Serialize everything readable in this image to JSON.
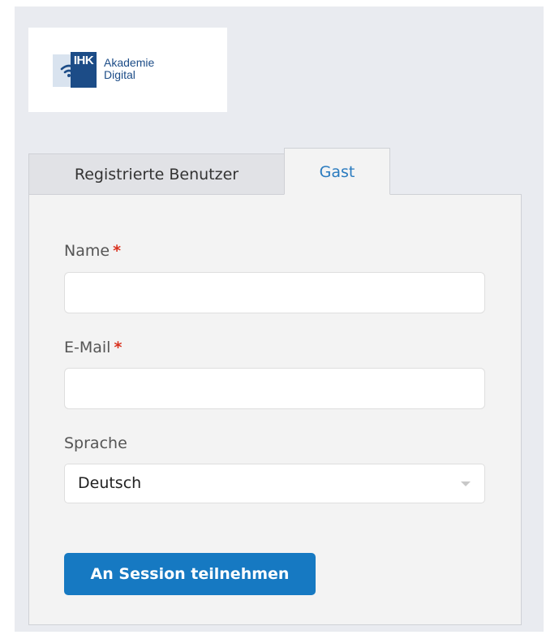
{
  "logo": {
    "mark_text": "IHK",
    "line1": "Akademie",
    "line2": "Digital",
    "icon": "wifi-icon"
  },
  "tabs": [
    {
      "label": "Registrierte Benutzer",
      "active": false
    },
    {
      "label": "Gast",
      "active": true
    }
  ],
  "form": {
    "name_label": "Name",
    "email_label": "E-Mail",
    "required_mark": "*",
    "name_value": "",
    "email_value": "",
    "language_label": "Sprache",
    "language_selected": "Deutsch",
    "submit_label": "An Session teilnehmen"
  },
  "colors": {
    "accent": "#1679c2",
    "active_tab_text": "#2a7bbf",
    "required": "#d9321f",
    "background": "#e9ebf0",
    "panel": "#f3f3f3"
  }
}
